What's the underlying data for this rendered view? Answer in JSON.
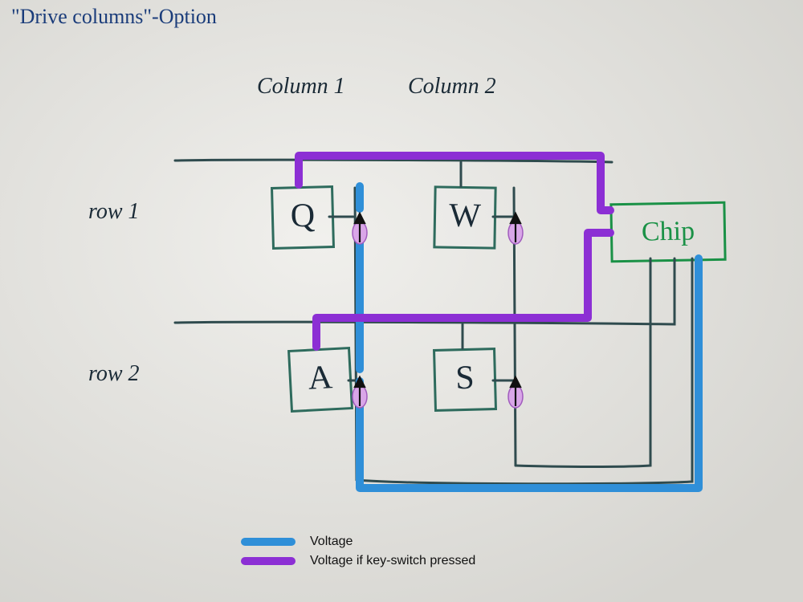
{
  "title": "\"Drive columns\"-Option",
  "columns": [
    "Column 1",
    "Column 2"
  ],
  "rows": [
    "row 1",
    "row 2"
  ],
  "keys": {
    "r1c1": "Q",
    "r1c2": "W",
    "r2c1": "A",
    "r2c2": "S"
  },
  "chip_label": "Chip",
  "colors": {
    "voltage": "#2f8fd8",
    "voltage_if_pressed": "#8c2fd4",
    "pen": "#2f4b4e",
    "key_border": "#2e6b5d",
    "chip_border": "#1a9146"
  },
  "legend": {
    "voltage": "Voltage",
    "voltage_if_pressed": "Voltage if key-switch pressed"
  }
}
